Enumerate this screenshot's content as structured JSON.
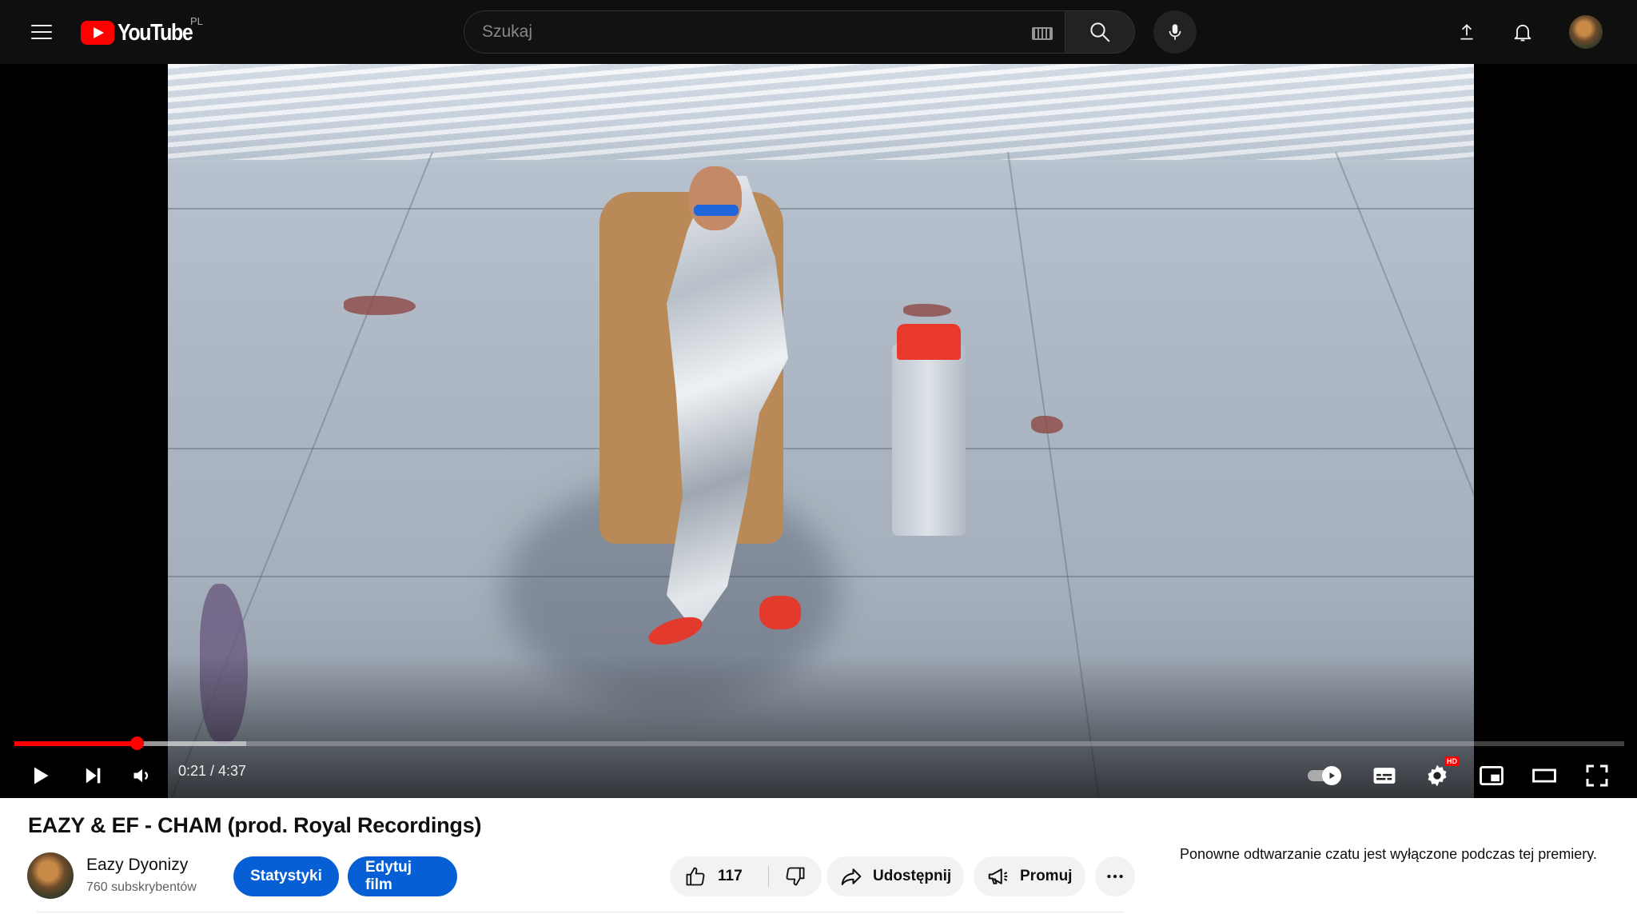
{
  "masthead": {
    "logo_text": "YouTube",
    "country_code": "PL",
    "search_placeholder": "Szukaj",
    "icons": [
      "menu-icon",
      "keyboard-icon",
      "search-icon",
      "microphone-icon",
      "upload-icon",
      "bell-icon"
    ]
  },
  "player": {
    "current_time": "0:21",
    "duration": "4:37",
    "time_display": "0:21 / 4:37",
    "progress_fraction": 0.0758,
    "buffered_fraction": 0.144,
    "hd_badge": "HD",
    "controls": [
      "play-icon",
      "next-icon",
      "volume-icon",
      "autoplay-toggle",
      "subtitles-icon",
      "settings-icon",
      "miniplayer-icon",
      "theater-icon",
      "fullscreen-icon"
    ],
    "accent_color": "#ff0000"
  },
  "video": {
    "title": "EAZY & EF - CHAM (prod. Royal Recordings)"
  },
  "channel": {
    "name": "Eazy Dyonizy",
    "subscribers": "760 subskrybentów"
  },
  "actions": {
    "stats_label": "Statystyki",
    "edit_label": "Edytuj film",
    "like_count": "117",
    "share_label": "Udostępnij",
    "promote_label": "Promuj",
    "primary_color": "#065fd4"
  },
  "chat": {
    "note": "Ponowne odtwarzanie czatu jest wyłączone podczas tej premiery."
  }
}
